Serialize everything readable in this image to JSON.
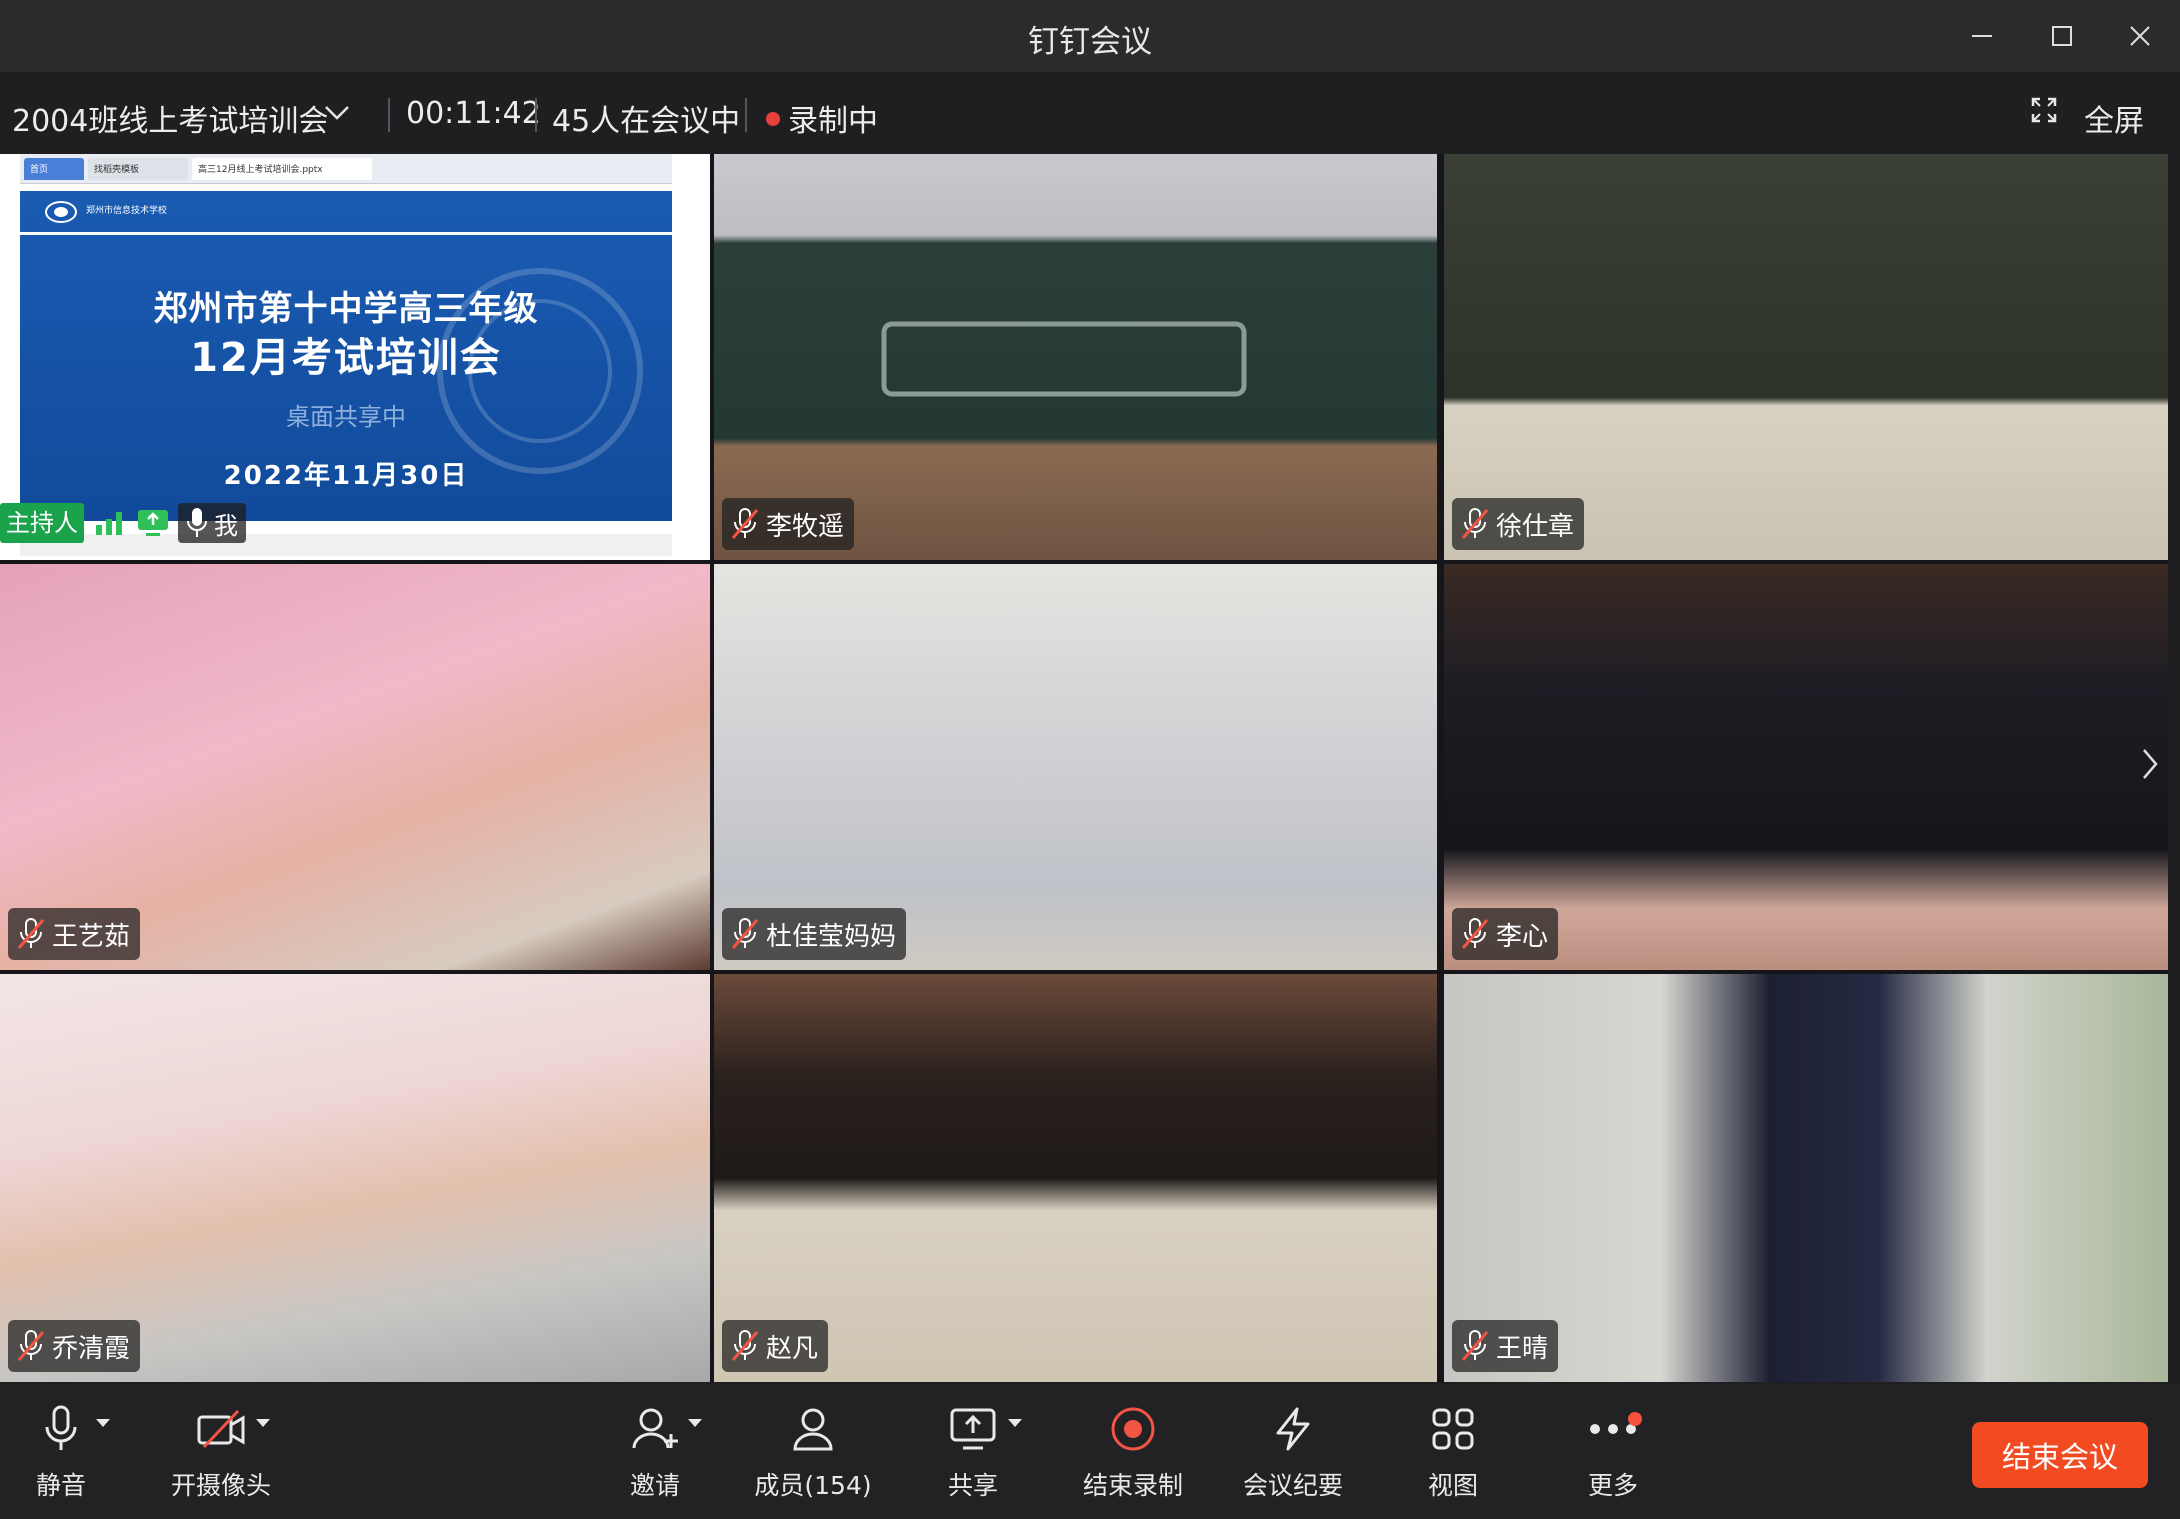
{
  "window": {
    "title": "钉钉会议"
  },
  "infobar": {
    "meeting_name": "2004班线上考试培训会",
    "elapsed": "00:11:42",
    "participants_in_meeting": "45人在会议中",
    "recording_status": "录制中",
    "fullscreen_label": "全屏"
  },
  "shared_screen": {
    "tabs": [
      "首页",
      "找稻壳模板",
      "高三12月线上考试培训会.pptx"
    ],
    "school_top": "郑州市信息技术学校",
    "slide_title_line1": "郑州市第十中学高三年级",
    "slide_title_line2": "12月考试培训会",
    "share_label": "桌面共享中",
    "slide_date": "2022年11月30日",
    "host_label": "主持人",
    "self_label": "我"
  },
  "participants": [
    {
      "name": "李牧遥"
    },
    {
      "name": "徐仕章"
    },
    {
      "name": "王艺茹"
    },
    {
      "name": "杜佳莹妈妈"
    },
    {
      "name": "李心"
    },
    {
      "name": "乔清霞"
    },
    {
      "name": "赵凡"
    },
    {
      "name": "王晴"
    }
  ],
  "toolbar": {
    "mute_label": "静音",
    "camera_label": "开摄像头",
    "invite_label": "邀请",
    "members_label": "成员(154)",
    "share_label": "共享",
    "stop_record_label": "结束录制",
    "minutes_label": "会议纪要",
    "view_label": "视图",
    "more_label": "更多",
    "end_meeting_label": "结束会议"
  },
  "colors": {
    "end_button": "#f24b22",
    "host_badge": "#1aa34a",
    "recording_dot": "#e8413a"
  }
}
